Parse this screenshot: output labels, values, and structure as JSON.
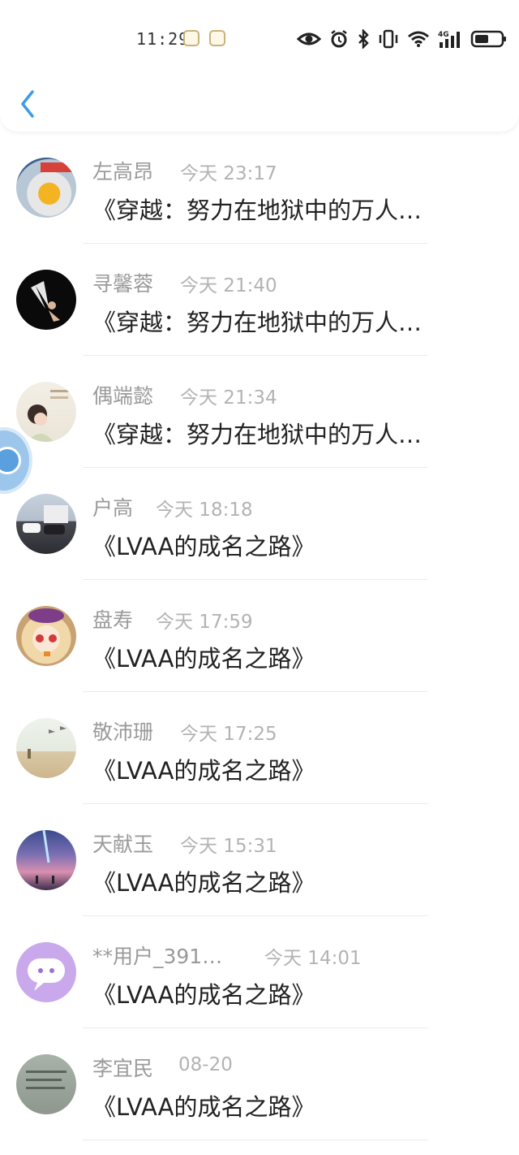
{
  "status_bar": {
    "time": "11:29"
  },
  "comments": [
    {
      "name": "左高昂",
      "date": "今天 23:17",
      "message": "《穿越：努力在地狱中的万人…"
    },
    {
      "name": "寻馨蓉",
      "date": "今天 21:40",
      "message": "《穿越：努力在地狱中的万人…"
    },
    {
      "name": "偶端懿",
      "date": "今天 21:34",
      "message": "《穿越：努力在地狱中的万人…"
    },
    {
      "name": "户高",
      "date": "今天 18:18",
      "message": "《LVAA的成名之路》"
    },
    {
      "name": "盘寿",
      "date": "今天 17:59",
      "message": "《LVAA的成名之路》"
    },
    {
      "name": "敬沛珊",
      "date": "今天 17:25",
      "message": "《LVAA的成名之路》"
    },
    {
      "name": "天献玉",
      "date": "今天 15:31",
      "message": "《LVAA的成名之路》"
    },
    {
      "name": "**用户_391…",
      "date": "今天 14:01",
      "message": "《LVAA的成名之路》"
    },
    {
      "name": "李宜民",
      "date": "08-20",
      "message": "《LVAA的成名之路》"
    }
  ],
  "colors": {
    "accent": "#3a9be8",
    "name_gray": "#9a9a9a",
    "message_dark": "#222222"
  }
}
